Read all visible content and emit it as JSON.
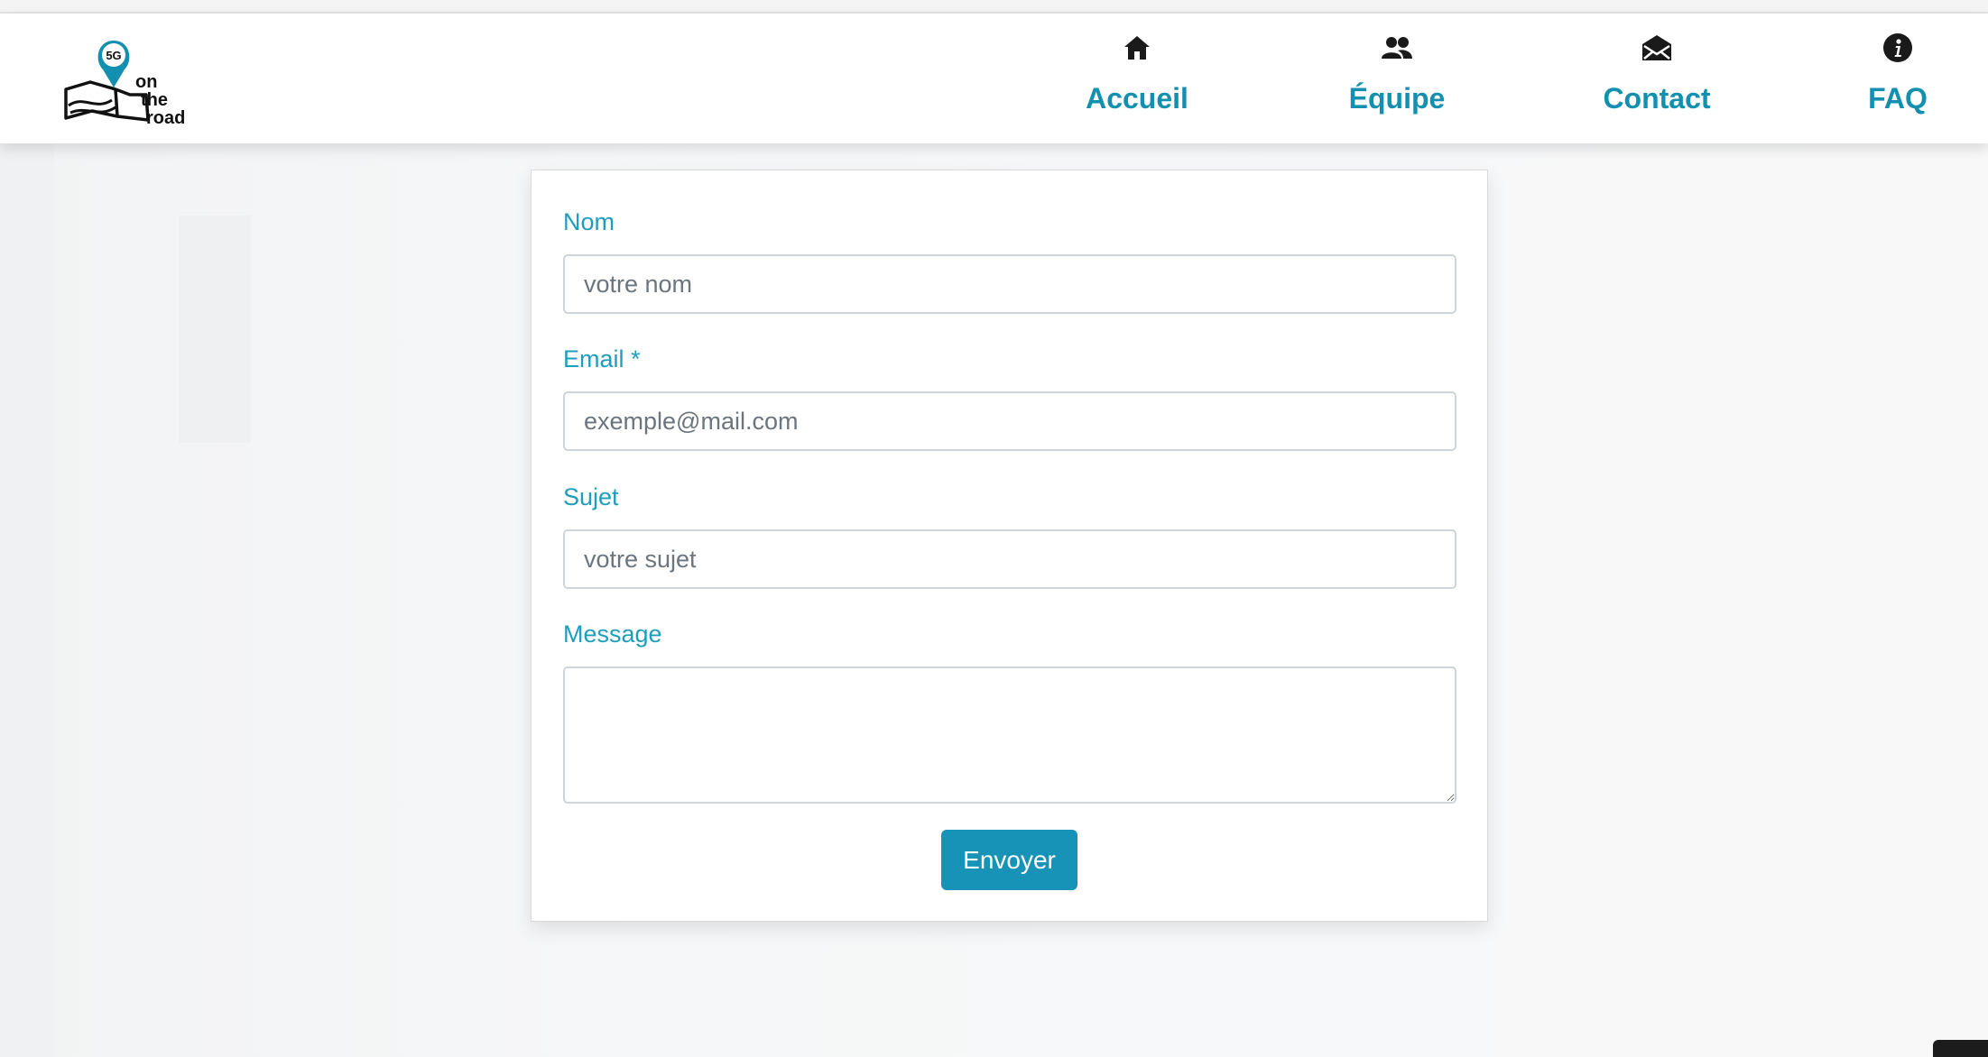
{
  "brand": {
    "logo_badge": "5G",
    "logo_text_lines": [
      "on",
      "the",
      "road"
    ],
    "accent_color": "#138fb0"
  },
  "nav": {
    "items": [
      {
        "label": "Accueil",
        "icon": "home-icon"
      },
      {
        "label": "Équipe",
        "icon": "users-icon"
      },
      {
        "label": "Contact",
        "icon": "envelope-open-icon"
      },
      {
        "label": "FAQ",
        "icon": "info-circle-icon"
      }
    ]
  },
  "form": {
    "fields": {
      "name": {
        "label": "Nom",
        "placeholder": "votre nom",
        "value": ""
      },
      "email": {
        "label": "Email *",
        "placeholder": "exemple@mail.com",
        "value": ""
      },
      "subject": {
        "label": "Sujet",
        "placeholder": "votre sujet",
        "value": ""
      },
      "message": {
        "label": "Message",
        "placeholder": "",
        "value": ""
      }
    },
    "submit_label": "Envoyer",
    "button_color": "#1693b6"
  }
}
